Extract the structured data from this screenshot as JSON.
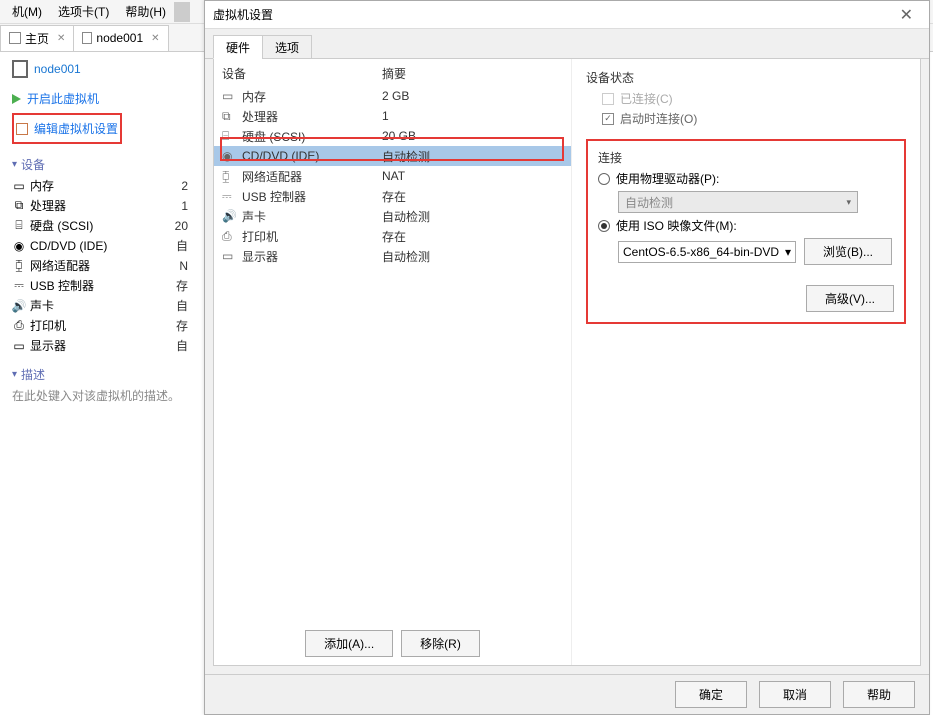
{
  "menubar": {
    "vm": "机(M)",
    "tabs": "选项卡(T)",
    "help": "帮助(H)"
  },
  "tabs": {
    "home": "主页",
    "node": "node001"
  },
  "vm": {
    "title": "node001"
  },
  "actions": {
    "power_on": "开启此虚拟机",
    "edit_settings": "编辑虚拟机设置"
  },
  "left_sections": {
    "devices": "设备",
    "description": "描述"
  },
  "left_devices": [
    {
      "name": "内存",
      "val": "2"
    },
    {
      "name": "处理器",
      "val": "1"
    },
    {
      "name": "硬盘 (SCSI)",
      "val": "20"
    },
    {
      "name": "CD/DVD (IDE)",
      "val": "自"
    },
    {
      "name": "网络适配器",
      "val": "N"
    },
    {
      "name": "USB 控制器",
      "val": "存"
    },
    {
      "name": "声卡",
      "val": "自"
    },
    {
      "name": "打印机",
      "val": "存"
    },
    {
      "name": "显示器",
      "val": "自"
    }
  ],
  "desc_placeholder": "在此处键入对该虚拟机的描述。",
  "dialog": {
    "title": "虚拟机设置",
    "tab_hardware": "硬件",
    "tab_options": "选项",
    "col_device": "设备",
    "col_summary": "摘要",
    "rows": [
      {
        "name": "内存",
        "summary": "2 GB"
      },
      {
        "name": "处理器",
        "summary": "1"
      },
      {
        "name": "硬盘 (SCSI)",
        "summary": "20 GB"
      },
      {
        "name": "CD/DVD (IDE)",
        "summary": "自动检测"
      },
      {
        "name": "网络适配器",
        "summary": "NAT"
      },
      {
        "name": "USB 控制器",
        "summary": "存在"
      },
      {
        "name": "声卡",
        "summary": "自动检测"
      },
      {
        "name": "打印机",
        "summary": "存在"
      },
      {
        "name": "显示器",
        "summary": "自动检测"
      }
    ],
    "add_btn": "添加(A)...",
    "remove_btn": "移除(R)",
    "status_label": "设备状态",
    "connected": "已连接(C)",
    "connect_on_power": "启动时连接(O)",
    "connection_label": "连接",
    "use_physical": "使用物理驱动器(P):",
    "auto_detect": "自动检测",
    "use_iso": "使用 ISO 映像文件(M):",
    "iso_file": "CentOS-6.5-x86_64-bin-DVD",
    "browse": "浏览(B)...",
    "advanced": "高级(V)...",
    "ok": "确定",
    "cancel": "取消",
    "help": "帮助"
  }
}
